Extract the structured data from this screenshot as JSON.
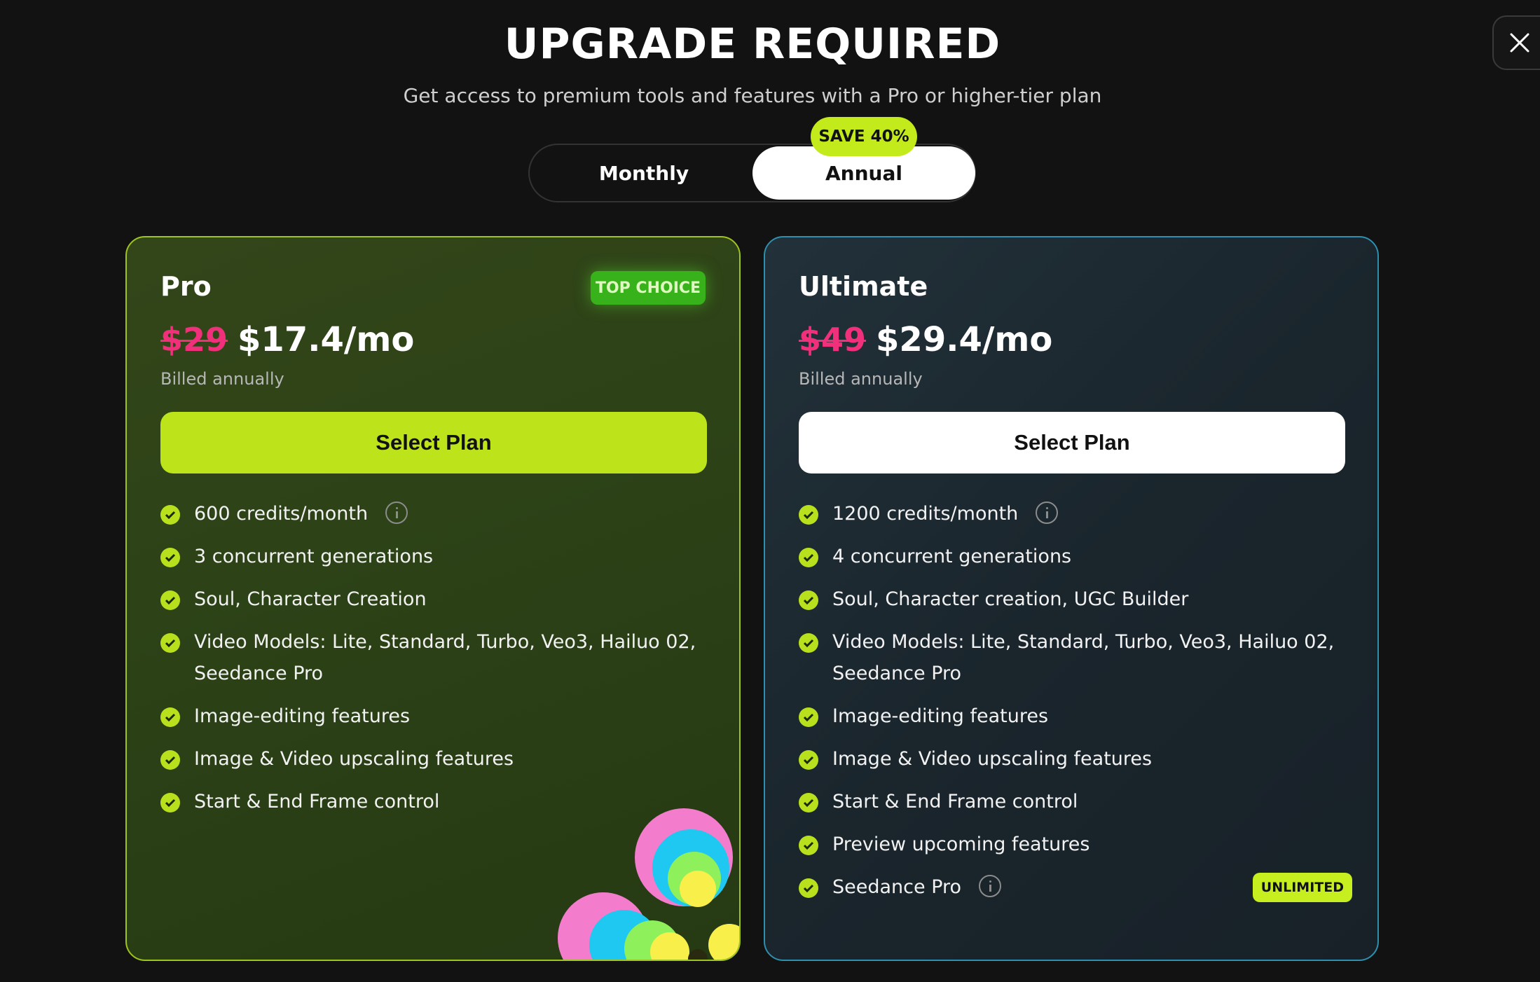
{
  "header": {
    "title": "UPGRADE REQUIRED",
    "subtitle": "Get access to premium tools and features with a Pro or higher-tier plan",
    "close_icon": "close-icon"
  },
  "billing_toggle": {
    "monthly_label": "Monthly",
    "annual_label": "Annual",
    "selected": "Annual",
    "badge": "SAVE 40%"
  },
  "colors": {
    "accent_lime": "#c3ea1a",
    "old_price_pink": "#f0307a",
    "pro_border": "#9ec41f",
    "ultimate_border": "#2e8fae"
  },
  "plans": [
    {
      "name": "Pro",
      "badge": "TOP CHOICE",
      "old_price": "$29",
      "new_price": "$17.4/mo",
      "billing_note": "Billed annually",
      "cta": "Select Plan",
      "features": [
        "600 credits/month",
        "3 concurrent generations",
        "Soul, Character Creation",
        "Video Models: Lite, Standard, Turbo, Veo3, Hailuo 02, Seedance Pro",
        "Image-editing features",
        "Image & Video upscaling features",
        "Start & End Frame control"
      ]
    },
    {
      "name": "Ultimate",
      "old_price": "$49",
      "new_price": "$29.4/mo",
      "billing_note": "Billed annually",
      "cta": "Select Plan",
      "features": [
        "1200 credits/month",
        "4 concurrent generations",
        "Soul, Character creation, UGC Builder",
        "Video Models: Lite, Standard, Turbo, Veo3, Hailuo 02, Seedance Pro",
        "Image-editing features",
        "Image & Video upscaling features",
        "Start & End Frame control",
        "Preview upcoming features",
        "Seedance Pro"
      ],
      "unlimited_badge": "UNLIMITED"
    }
  ]
}
